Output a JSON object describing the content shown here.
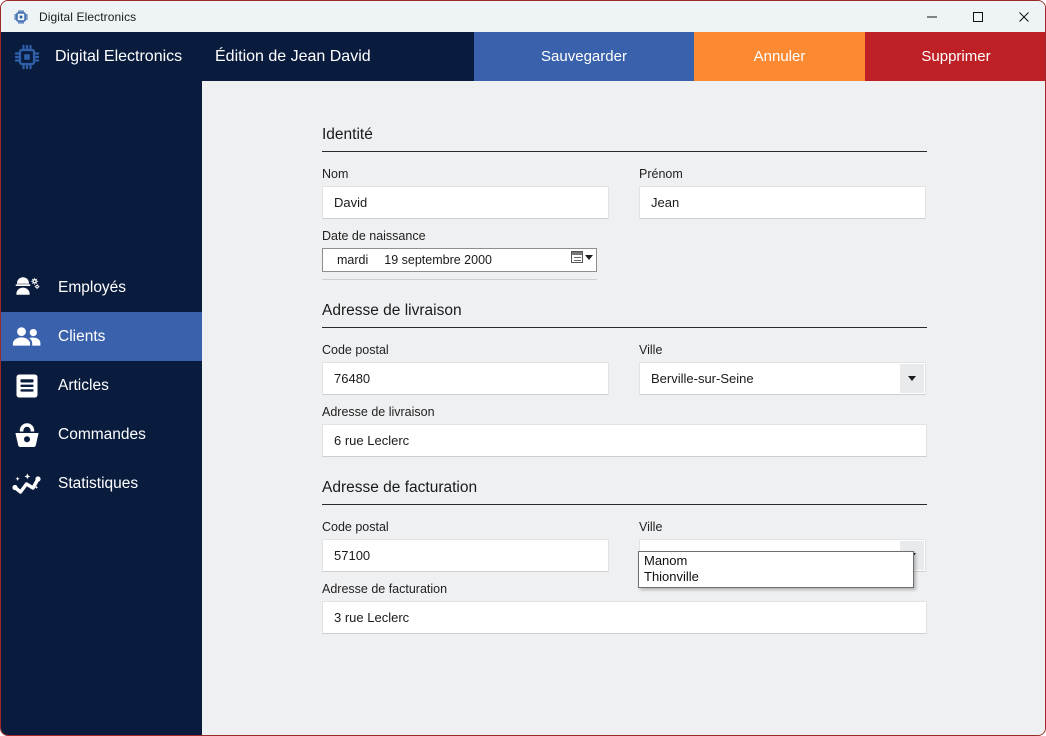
{
  "window": {
    "title": "Digital Electronics",
    "icon": "chip-icon",
    "minimize_label": "—",
    "maximize_label": "☐",
    "close_label": "✕"
  },
  "header": {
    "brand": "Digital Electronics",
    "brand_icon": "chip-icon",
    "page_title": "Édition de Jean David",
    "buttons": [
      {
        "label": "Sauvegarder",
        "color": "#3a62ac"
      },
      {
        "label": "Annuler",
        "color": "#fb8a33"
      },
      {
        "label": "Supprimer",
        "color": "#bf2026"
      }
    ]
  },
  "sidebar": {
    "items": [
      {
        "label": "Employés",
        "icon": "engineer-gear-icon",
        "active": false
      },
      {
        "label": "Clients",
        "icon": "people-icon",
        "active": true
      },
      {
        "label": "Articles",
        "icon": "article-list-icon",
        "active": false
      },
      {
        "label": "Commandes",
        "icon": "basket-icon",
        "active": false
      },
      {
        "label": "Statistiques",
        "icon": "line-chart-icon",
        "active": false
      }
    ],
    "active_color": "#3a62ac",
    "background": "#0a1c3d"
  },
  "form": {
    "identity": {
      "section_title": "Identité",
      "nom_label": "Nom",
      "nom_value": "David",
      "prenom_label": "Prénom",
      "prenom_value": "Jean",
      "birth_label": "Date de naissance",
      "birth_day": "mardi",
      "birth_date": "19 septembre 2000"
    },
    "shipping": {
      "section_title": "Adresse de livraison",
      "postal_label": "Code postal",
      "postal_value": "76480",
      "city_label": "Ville",
      "city_value": "Berville-sur-Seine",
      "address_label": "Adresse de livraison",
      "address_value": "6 rue Leclerc"
    },
    "billing": {
      "section_title": "Adresse de facturation",
      "postal_label": "Code postal",
      "postal_value": "57100",
      "city_label": "Ville",
      "city_value": "",
      "city_options": [
        "Manom",
        "Thionville"
      ],
      "address_label": "Adresse de facturation",
      "address_value": "3 rue Leclerc"
    }
  }
}
